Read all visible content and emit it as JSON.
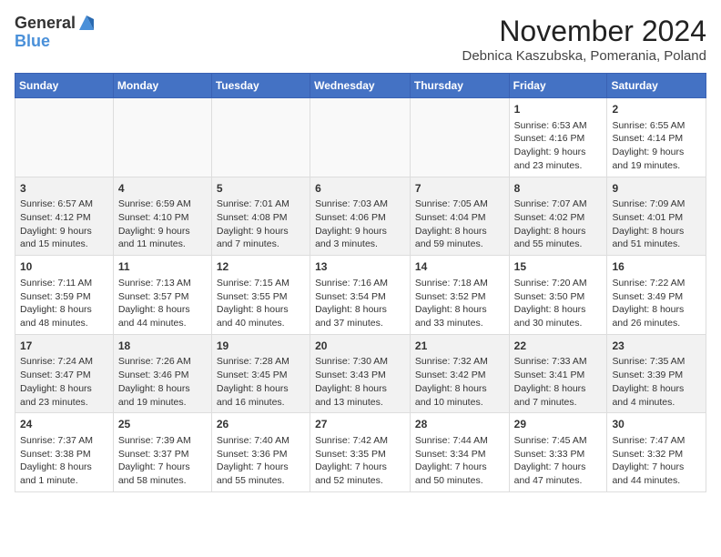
{
  "logo": {
    "line1": "General",
    "line2": "Blue"
  },
  "title": "November 2024",
  "subtitle": "Debnica Kaszubska, Pomerania, Poland",
  "weekdays": [
    "Sunday",
    "Monday",
    "Tuesday",
    "Wednesday",
    "Thursday",
    "Friday",
    "Saturday"
  ],
  "weeks": [
    [
      {
        "day": "",
        "info": ""
      },
      {
        "day": "",
        "info": ""
      },
      {
        "day": "",
        "info": ""
      },
      {
        "day": "",
        "info": ""
      },
      {
        "day": "",
        "info": ""
      },
      {
        "day": "1",
        "info": "Sunrise: 6:53 AM\nSunset: 4:16 PM\nDaylight: 9 hours\nand 23 minutes."
      },
      {
        "day": "2",
        "info": "Sunrise: 6:55 AM\nSunset: 4:14 PM\nDaylight: 9 hours\nand 19 minutes."
      }
    ],
    [
      {
        "day": "3",
        "info": "Sunrise: 6:57 AM\nSunset: 4:12 PM\nDaylight: 9 hours\nand 15 minutes."
      },
      {
        "day": "4",
        "info": "Sunrise: 6:59 AM\nSunset: 4:10 PM\nDaylight: 9 hours\nand 11 minutes."
      },
      {
        "day": "5",
        "info": "Sunrise: 7:01 AM\nSunset: 4:08 PM\nDaylight: 9 hours\nand 7 minutes."
      },
      {
        "day": "6",
        "info": "Sunrise: 7:03 AM\nSunset: 4:06 PM\nDaylight: 9 hours\nand 3 minutes."
      },
      {
        "day": "7",
        "info": "Sunrise: 7:05 AM\nSunset: 4:04 PM\nDaylight: 8 hours\nand 59 minutes."
      },
      {
        "day": "8",
        "info": "Sunrise: 7:07 AM\nSunset: 4:02 PM\nDaylight: 8 hours\nand 55 minutes."
      },
      {
        "day": "9",
        "info": "Sunrise: 7:09 AM\nSunset: 4:01 PM\nDaylight: 8 hours\nand 51 minutes."
      }
    ],
    [
      {
        "day": "10",
        "info": "Sunrise: 7:11 AM\nSunset: 3:59 PM\nDaylight: 8 hours\nand 48 minutes."
      },
      {
        "day": "11",
        "info": "Sunrise: 7:13 AM\nSunset: 3:57 PM\nDaylight: 8 hours\nand 44 minutes."
      },
      {
        "day": "12",
        "info": "Sunrise: 7:15 AM\nSunset: 3:55 PM\nDaylight: 8 hours\nand 40 minutes."
      },
      {
        "day": "13",
        "info": "Sunrise: 7:16 AM\nSunset: 3:54 PM\nDaylight: 8 hours\nand 37 minutes."
      },
      {
        "day": "14",
        "info": "Sunrise: 7:18 AM\nSunset: 3:52 PM\nDaylight: 8 hours\nand 33 minutes."
      },
      {
        "day": "15",
        "info": "Sunrise: 7:20 AM\nSunset: 3:50 PM\nDaylight: 8 hours\nand 30 minutes."
      },
      {
        "day": "16",
        "info": "Sunrise: 7:22 AM\nSunset: 3:49 PM\nDaylight: 8 hours\nand 26 minutes."
      }
    ],
    [
      {
        "day": "17",
        "info": "Sunrise: 7:24 AM\nSunset: 3:47 PM\nDaylight: 8 hours\nand 23 minutes."
      },
      {
        "day": "18",
        "info": "Sunrise: 7:26 AM\nSunset: 3:46 PM\nDaylight: 8 hours\nand 19 minutes."
      },
      {
        "day": "19",
        "info": "Sunrise: 7:28 AM\nSunset: 3:45 PM\nDaylight: 8 hours\nand 16 minutes."
      },
      {
        "day": "20",
        "info": "Sunrise: 7:30 AM\nSunset: 3:43 PM\nDaylight: 8 hours\nand 13 minutes."
      },
      {
        "day": "21",
        "info": "Sunrise: 7:32 AM\nSunset: 3:42 PM\nDaylight: 8 hours\nand 10 minutes."
      },
      {
        "day": "22",
        "info": "Sunrise: 7:33 AM\nSunset: 3:41 PM\nDaylight: 8 hours\nand 7 minutes."
      },
      {
        "day": "23",
        "info": "Sunrise: 7:35 AM\nSunset: 3:39 PM\nDaylight: 8 hours\nand 4 minutes."
      }
    ],
    [
      {
        "day": "24",
        "info": "Sunrise: 7:37 AM\nSunset: 3:38 PM\nDaylight: 8 hours\nand 1 minute."
      },
      {
        "day": "25",
        "info": "Sunrise: 7:39 AM\nSunset: 3:37 PM\nDaylight: 7 hours\nand 58 minutes."
      },
      {
        "day": "26",
        "info": "Sunrise: 7:40 AM\nSunset: 3:36 PM\nDaylight: 7 hours\nand 55 minutes."
      },
      {
        "day": "27",
        "info": "Sunrise: 7:42 AM\nSunset: 3:35 PM\nDaylight: 7 hours\nand 52 minutes."
      },
      {
        "day": "28",
        "info": "Sunrise: 7:44 AM\nSunset: 3:34 PM\nDaylight: 7 hours\nand 50 minutes."
      },
      {
        "day": "29",
        "info": "Sunrise: 7:45 AM\nSunset: 3:33 PM\nDaylight: 7 hours\nand 47 minutes."
      },
      {
        "day": "30",
        "info": "Sunrise: 7:47 AM\nSunset: 3:32 PM\nDaylight: 7 hours\nand 44 minutes."
      }
    ]
  ]
}
